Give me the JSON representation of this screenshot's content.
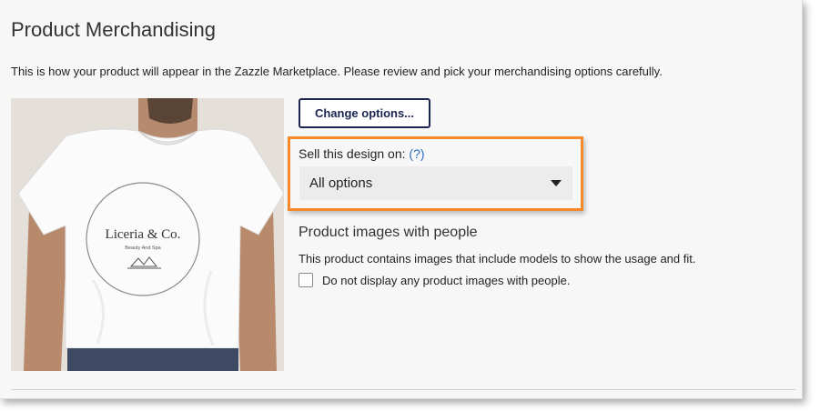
{
  "page": {
    "title": "Product Merchandising",
    "intro": "This is how your product will appear in the Zazzle Marketplace. Please review and pick your merchandising options carefully."
  },
  "product_image": {
    "logo_text": "Liceria & Co.",
    "logo_subtext": "Beauty And Spa"
  },
  "actions": {
    "change_options_label": "Change options..."
  },
  "sell_on": {
    "label": "Sell this design on:",
    "help": "(?)",
    "selected_value": "All options",
    "highlight_color": "#f7892b"
  },
  "people_images": {
    "heading": "Product images with people",
    "description": "This product contains images that include models to show the usage and fit.",
    "checkbox_label": "Do not display any product images with people.",
    "checked": false
  },
  "colors": {
    "button_border": "#1b2550",
    "link": "#2a6bbf",
    "panel_bg": "#f7f7f7"
  }
}
